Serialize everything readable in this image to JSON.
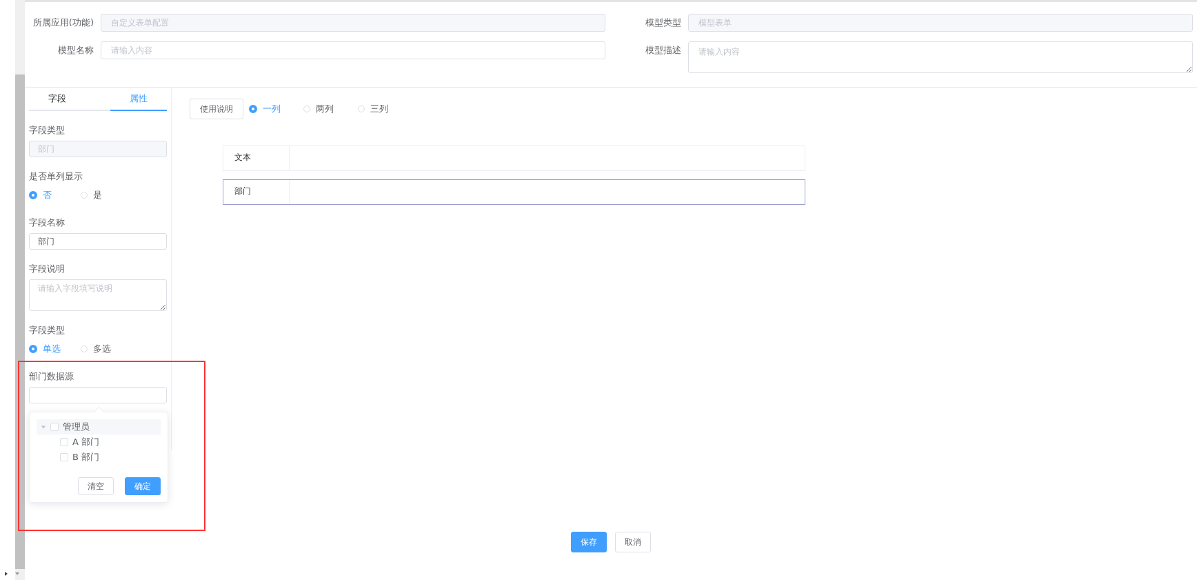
{
  "top_form": {
    "fields": [
      {
        "kind": "input",
        "label": "所属应用(功能)",
        "value": "自定义表单配置",
        "disabled": true
      },
      {
        "kind": "input",
        "label": "模型类型",
        "value": "模型表单",
        "disabled": true
      },
      {
        "kind": "input",
        "label": "模型名称",
        "placeholder": "请输入内容"
      },
      {
        "kind": "textarea",
        "label": "模型描述",
        "placeholder": "请输入内容"
      }
    ]
  },
  "side_panel": {
    "tabs": [
      {
        "label": "字段",
        "selected": false
      },
      {
        "label": "属性",
        "selected": true
      }
    ],
    "properties": [
      {
        "kind": "input",
        "label": "字段类型",
        "value": "部门",
        "disabled": true
      },
      {
        "kind": "radio",
        "label": "是否单列显示",
        "options": [
          {
            "label": "否",
            "selected": true
          },
          {
            "label": "是",
            "selected": false
          }
        ]
      },
      {
        "kind": "input",
        "label": "字段名称",
        "value": "部门"
      },
      {
        "kind": "textarea",
        "label": "字段说明",
        "placeholder": "请输入字段填写说明"
      },
      {
        "kind": "radio",
        "label": "字段类型",
        "options": [
          {
            "label": "单选",
            "selected": true
          },
          {
            "label": "多选",
            "selected": false
          }
        ]
      },
      {
        "kind": "tree-select",
        "label": "部门数据源"
      }
    ]
  },
  "dropdown": {
    "tree": [
      {
        "label": "管理员",
        "checked": false,
        "expanded": true,
        "children": [
          {
            "label": "A 部门",
            "checked": false
          },
          {
            "label": "B 部门",
            "checked": false
          }
        ]
      }
    ],
    "buttons": [
      {
        "label": "清空",
        "kind": "default"
      },
      {
        "label": "确定",
        "kind": "primary"
      }
    ]
  },
  "canvas": {
    "help_button": "使用说明",
    "layout_options": [
      {
        "label": "一列",
        "selected": true
      },
      {
        "label": "两列",
        "selected": false
      },
      {
        "label": "三列",
        "selected": false
      }
    ],
    "rows": [
      {
        "label": "文本",
        "selected": false
      },
      {
        "label": "部门",
        "selected": true
      }
    ]
  },
  "footer": {
    "buttons": [
      {
        "label": "保存",
        "kind": "primary"
      },
      {
        "label": "取消",
        "kind": "default"
      }
    ]
  }
}
